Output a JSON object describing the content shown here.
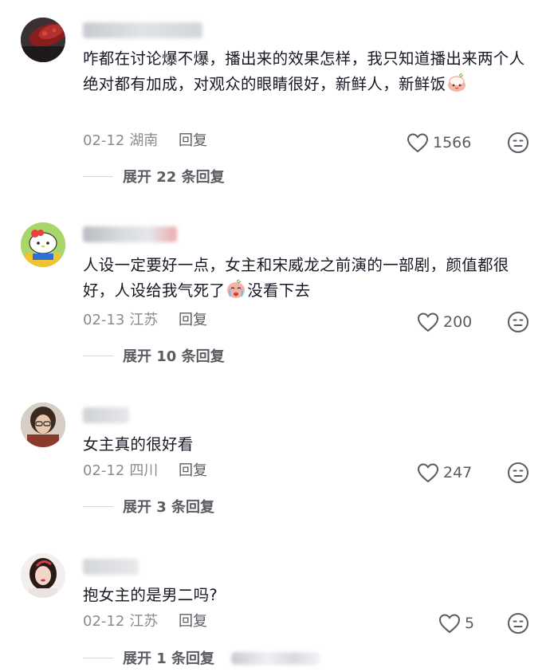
{
  "comments": [
    {
      "text": "咋都在讨论爆不爆，播出来的效果怎样，我只知道播出来两个人绝对都有加成，对观众的眼睛很好，新鲜人，新鲜饭",
      "date": "02-12",
      "location": "湖南",
      "reply_label": "回复",
      "likes": "1566",
      "expand_label": "展开 22 条回复"
    },
    {
      "text_before_emoji": "人设一定要好一点，女主和宋威龙之前演的一部剧，颜值都很好，人设给我气死了",
      "text_after_emoji": "没看下去",
      "date": "02-13",
      "location": "江苏",
      "reply_label": "回复",
      "likes": "200",
      "expand_label": "展开 10 条回复"
    },
    {
      "text": "女主真的很好看",
      "date": "02-12",
      "location": "四川",
      "reply_label": "回复",
      "likes": "247",
      "expand_label": "展开 3 条回复"
    },
    {
      "text": "抱女主的是男二吗?",
      "date": "02-12",
      "location": "江苏",
      "reply_label": "回复",
      "likes": "5",
      "expand_label": "展开 1 条回复"
    }
  ],
  "icons": {
    "like": "heart-outline-icon",
    "dislike": "meh-face-icon",
    "emoji_1": "rice-bowl-emoji",
    "emoji_2": "crying-face-emoji"
  },
  "colors": {
    "text": "#161823",
    "meta": "#8a8b91",
    "action": "#5b5c63"
  }
}
